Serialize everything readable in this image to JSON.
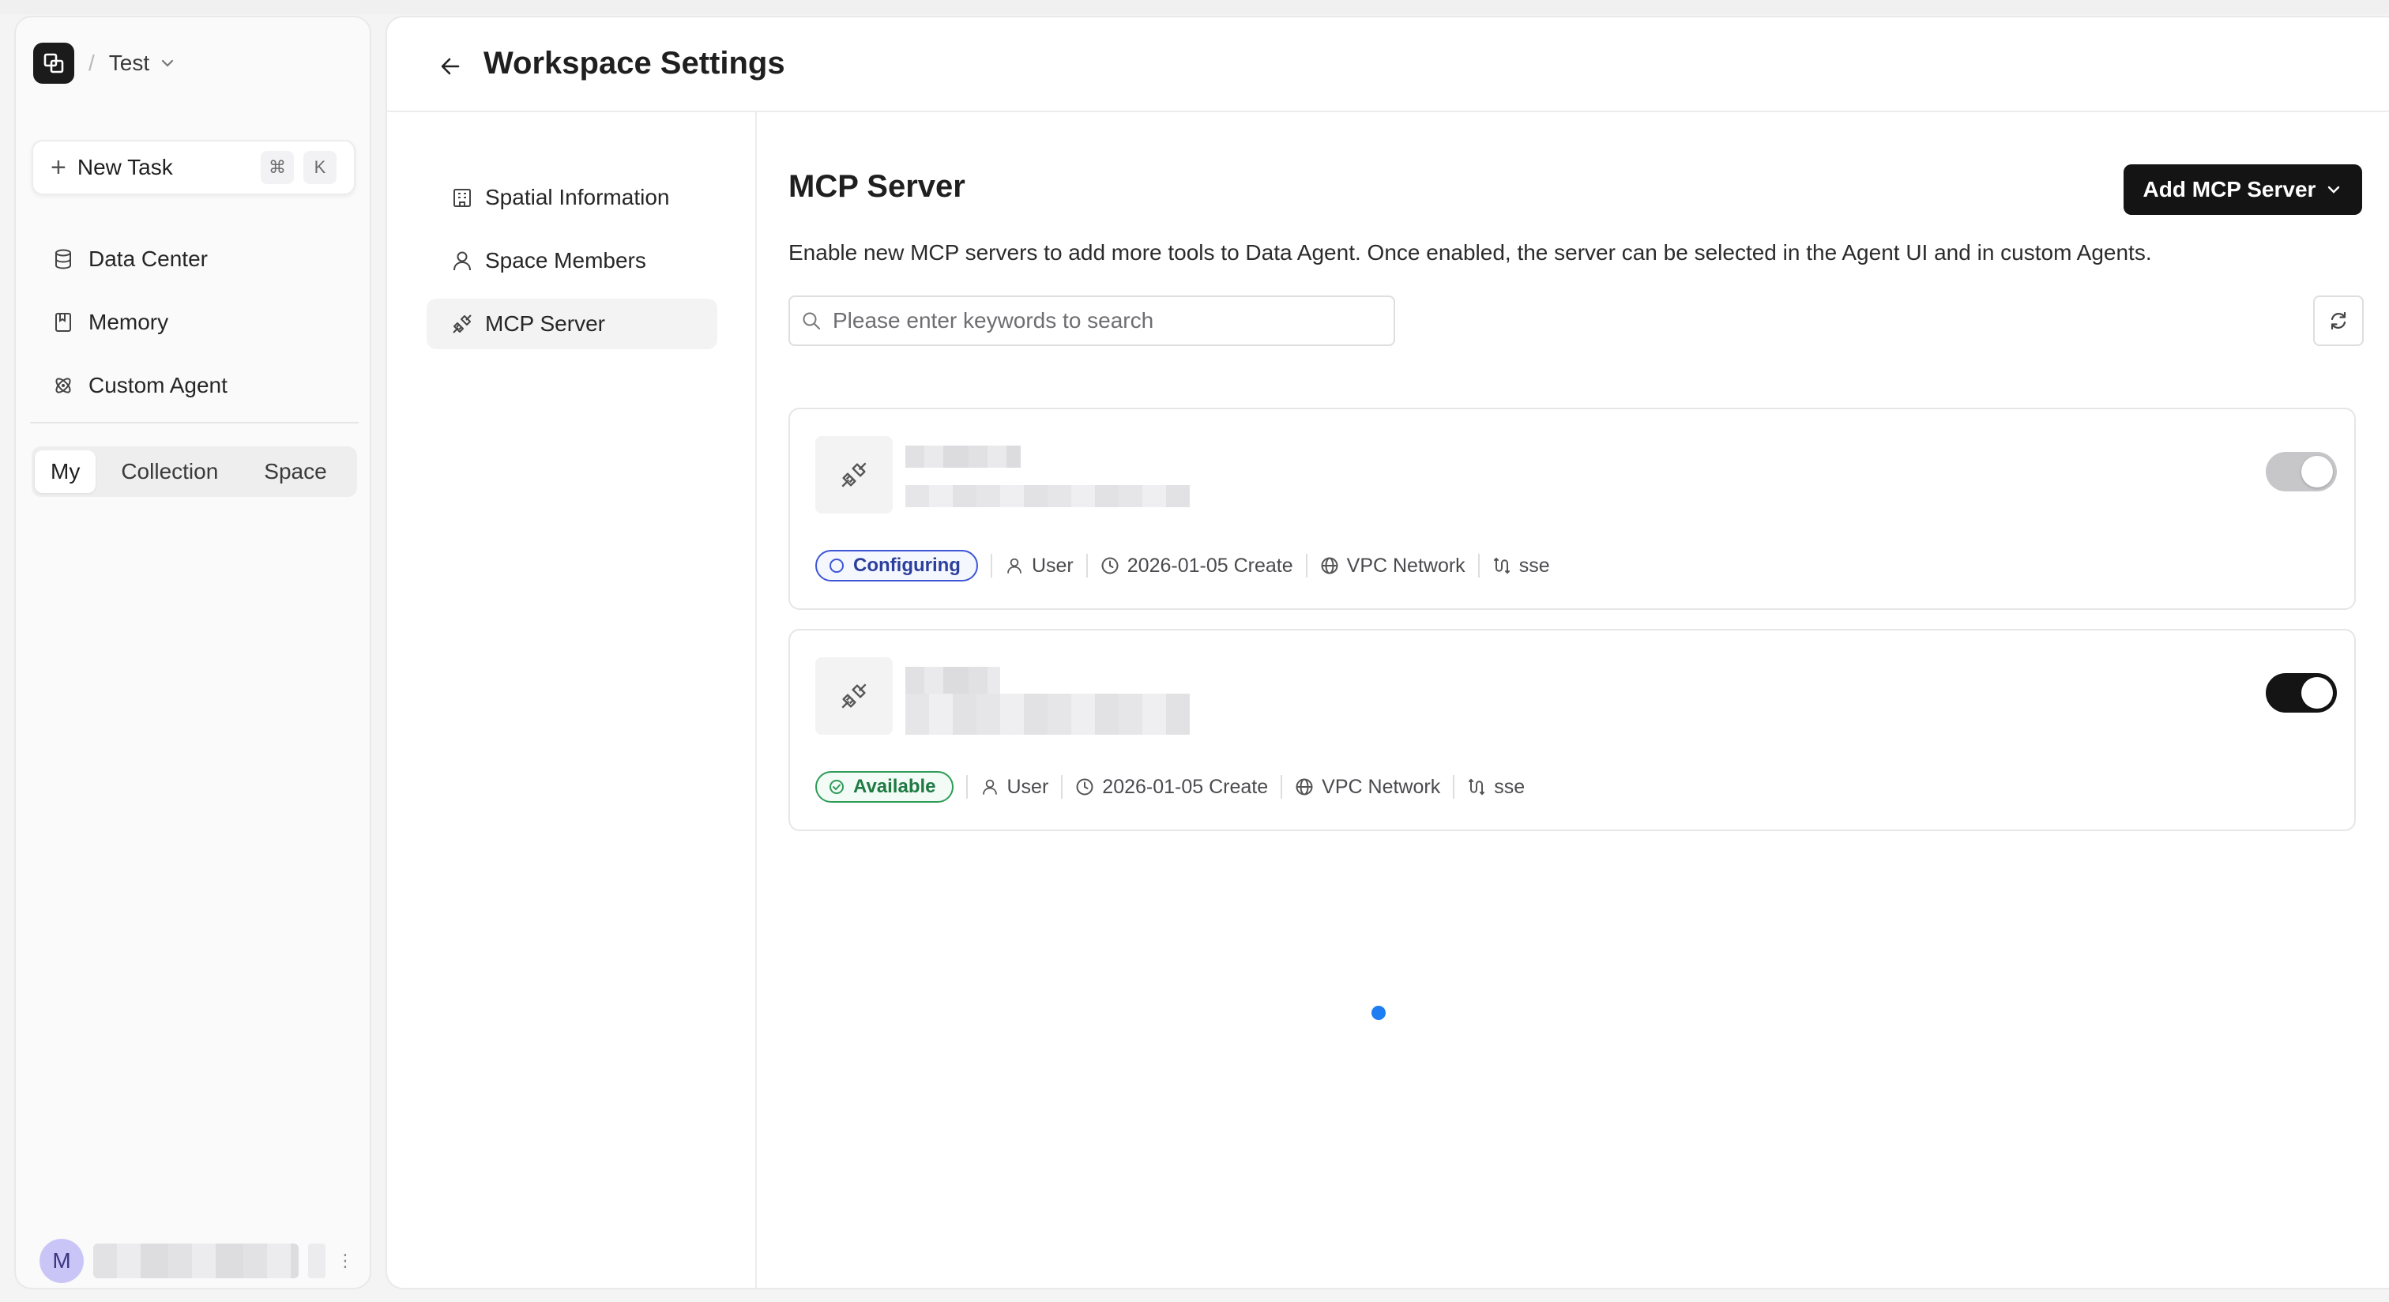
{
  "workspace": {
    "name": "Test"
  },
  "sidebar": {
    "new_task": {
      "label": "New Task",
      "shortcut_mod": "⌘",
      "shortcut_key": "K"
    },
    "items": [
      {
        "label": "Data Center",
        "icon": "database-icon"
      },
      {
        "label": "Memory",
        "icon": "notebook-icon"
      },
      {
        "label": "Custom Agent",
        "icon": "atom-icon"
      }
    ],
    "tabs": [
      {
        "label": "My",
        "active": true
      },
      {
        "label": "Collection",
        "active": false
      },
      {
        "label": "Space",
        "active": false
      }
    ],
    "user": {
      "initial": "M"
    }
  },
  "header": {
    "title": "Workspace Settings"
  },
  "settings_nav": [
    {
      "label": "Spatial Information",
      "icon": "building-icon",
      "active": false
    },
    {
      "label": "Space Members",
      "icon": "user-icon",
      "active": false
    },
    {
      "label": "MCP Server",
      "icon": "plug-icon",
      "active": true
    }
  ],
  "mcp": {
    "title": "MCP Server",
    "add_button": "Add MCP Server",
    "description": "Enable new MCP servers to add more tools to Data Agent. Once enabled, the server can be selected in the Agent UI and in custom Agents.",
    "search_placeholder": "Please enter keywords to search",
    "servers": [
      {
        "status": "Configuring",
        "owner": "User",
        "created": "2026-01-05 Create",
        "network": "VPC Network",
        "transport": "sse",
        "enabled": false
      },
      {
        "status": "Available",
        "owner": "User",
        "created": "2026-01-05 Create",
        "network": "VPC Network",
        "transport": "sse",
        "enabled": true
      }
    ]
  },
  "colors": {
    "accent": "#141414",
    "configuring": "#3d55d6",
    "available": "#2e9b57",
    "loading_dot": "#1e7df2"
  }
}
